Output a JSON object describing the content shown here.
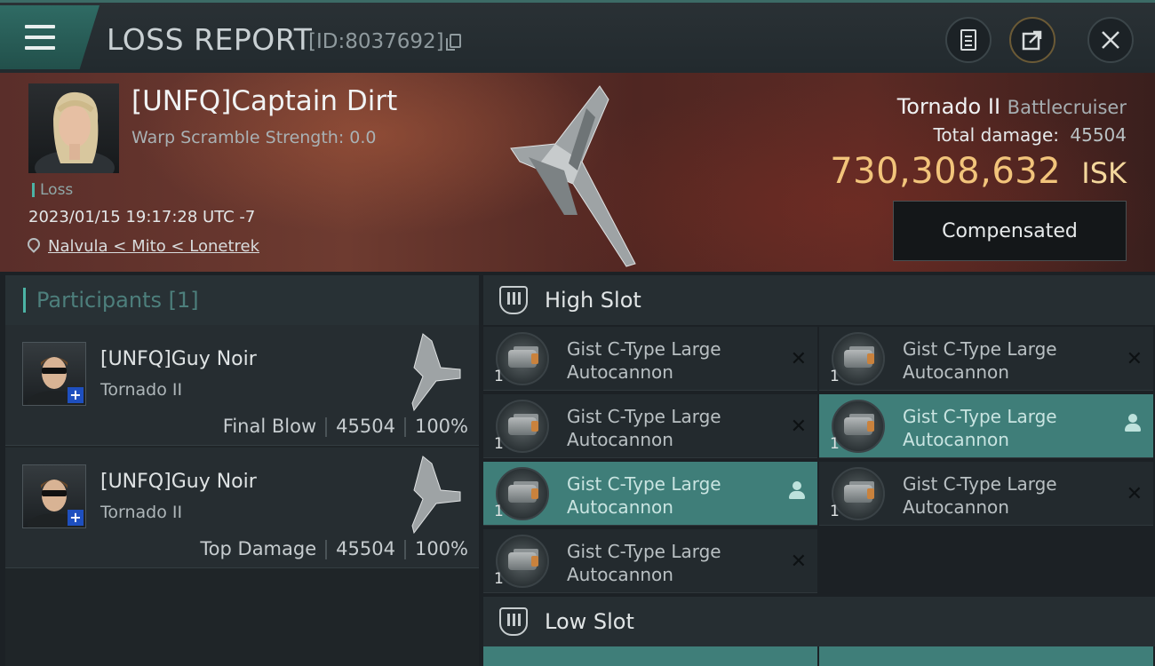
{
  "header": {
    "title": "LOSS REPORT",
    "report_id": "[ID:8037692]"
  },
  "victim": {
    "pilot": "[UNFQ]Captain Dirt",
    "scramble": "Warp Scramble Strength: 0.0",
    "status": "Loss",
    "timestamp": "2023/01/15 19:17:28 UTC -7",
    "location": "Nalvula < Mito < Lonetrek",
    "ship": "Tornado II",
    "ship_class": "Battlecruiser",
    "damage_label": "Total damage:",
    "damage_value": "45504",
    "isk_value": "730,308,632",
    "isk_unit": "ISK",
    "comp_label": "Compensated"
  },
  "participants": {
    "title": "Participants [1]",
    "list": [
      {
        "name": "[UNFQ]Guy Noir",
        "ship": "Tornado II",
        "role": "Final Blow",
        "damage": "45504",
        "percent": "100%"
      },
      {
        "name": "[UNFQ]Guy Noir",
        "ship": "Tornado II",
        "role": "Top Damage",
        "damage": "45504",
        "percent": "100%"
      }
    ]
  },
  "slots": {
    "high_title": "High Slot",
    "low_title": "Low Slot",
    "modules": [
      {
        "line1": "Gist C-Type Large",
        "line2": "Autocannon",
        "qty": "1"
      },
      {
        "line1": "Gist C-Type Large",
        "line2": "Autocannon",
        "qty": "1"
      },
      {
        "line1": "Gist C-Type Large",
        "line2": "Autocannon",
        "qty": "1"
      },
      {
        "line1": "Gist C-Type Large",
        "line2": "Autocannon",
        "qty": "1"
      },
      {
        "line1": "Gist C-Type Large",
        "line2": "Autocannon",
        "qty": "1"
      },
      {
        "line1": "Gist C-Type Large",
        "line2": "Autocannon",
        "qty": "1"
      },
      {
        "line1": "Gist C-Type Large",
        "line2": "Autocannon",
        "qty": "1"
      }
    ]
  },
  "colors": {
    "accent_teal": "#3f7e79",
    "isk_gold": "#f2c47b",
    "loss_marker": "#4cb3a5"
  }
}
